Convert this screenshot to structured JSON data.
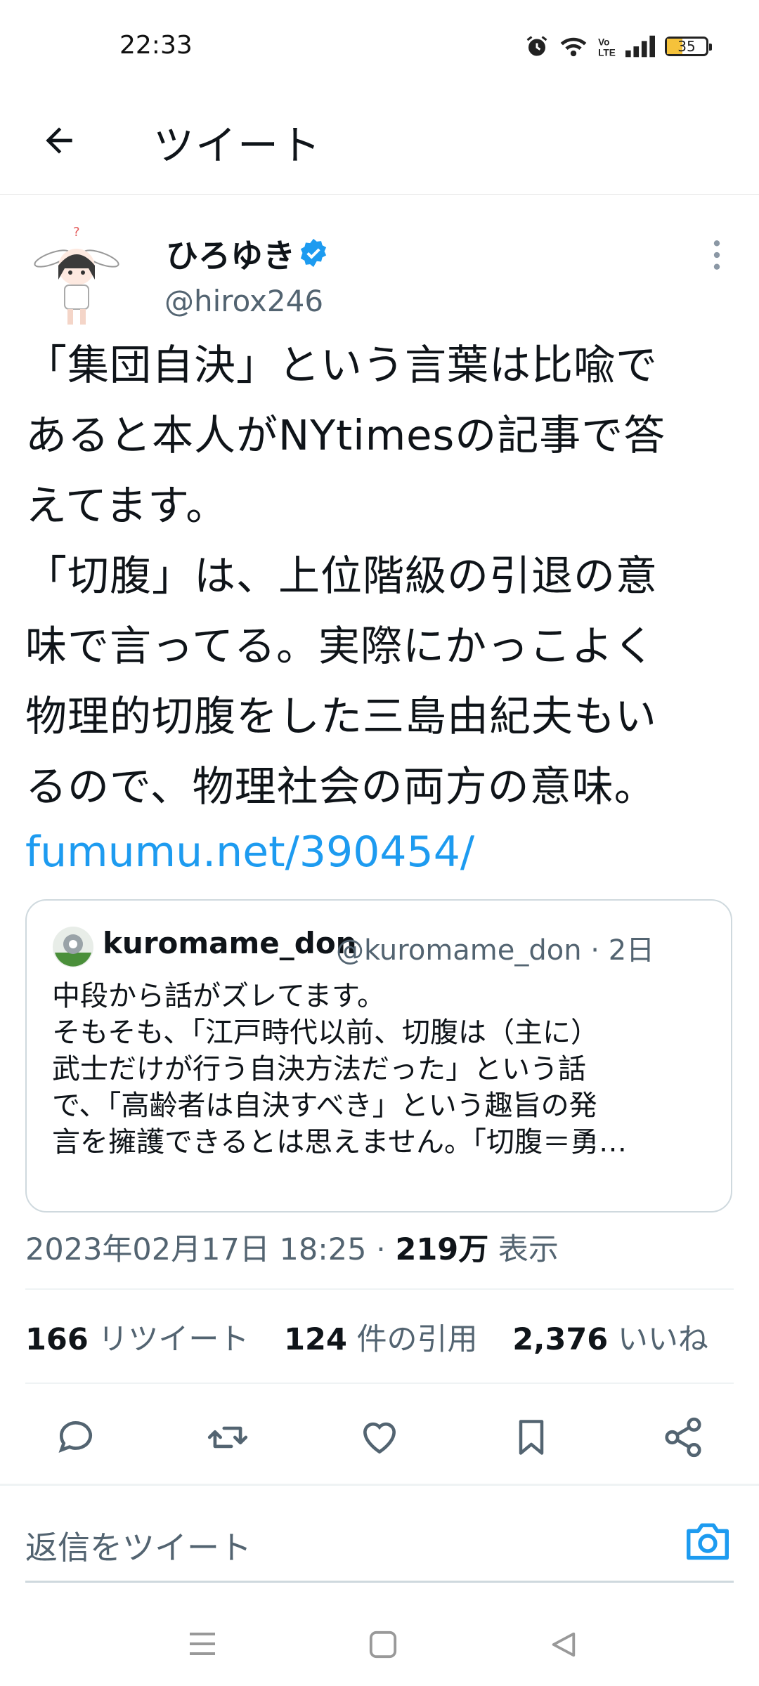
{
  "status_bar": {
    "time": "22:33",
    "battery": "35"
  },
  "header": {
    "title": "ツイート"
  },
  "tweet": {
    "author_name": "ひろゆき",
    "author_handle": "@hirox246",
    "text": "「集団自決」という言葉は比喩で\nあると本人がNYtimesの記事で答\nえてます。\n「切腹」は、上位階級の引退の意\n味で言ってる。実際にかっこよく\n物理的切腹をした三島由紀夫もい\nるので、物理社会の両方の意味。",
    "link": "fumumu.net/390454/"
  },
  "quote": {
    "name": "kuromame_don",
    "meta": "@kuromame_don · 2日",
    "text": "中段から話がズレてます。\nそもそも、「江戸時代以前、切腹は（主に）\n武士だけが行う自決方法だった」という話\nで、「高齢者は自決すべき」という趣旨の発\n言を擁護できるとは思えません。「切腹＝勇…"
  },
  "meta": {
    "timestamp": "2023年02月17日 18:25 · ",
    "views_count": "219万",
    "views_label": " 表示"
  },
  "stats": {
    "retweets_count": "166",
    "retweets_label": " リツイート",
    "quotes_count": "124",
    "quotes_label": " 件の引用",
    "likes_count": "2,376",
    "likes_label": " いいね"
  },
  "reply": {
    "placeholder": "返信をツイート"
  },
  "colors": {
    "accent": "#1d9bf0",
    "text": "#0f1419",
    "secondary": "#536471"
  },
  "icons": [
    "back-arrow-icon",
    "verified-badge-icon",
    "more-vertical-icon",
    "reply-icon",
    "retweet-icon",
    "like-icon",
    "bookmark-icon",
    "share-icon",
    "camera-icon",
    "menu-icon",
    "home-icon",
    "back-icon"
  ]
}
